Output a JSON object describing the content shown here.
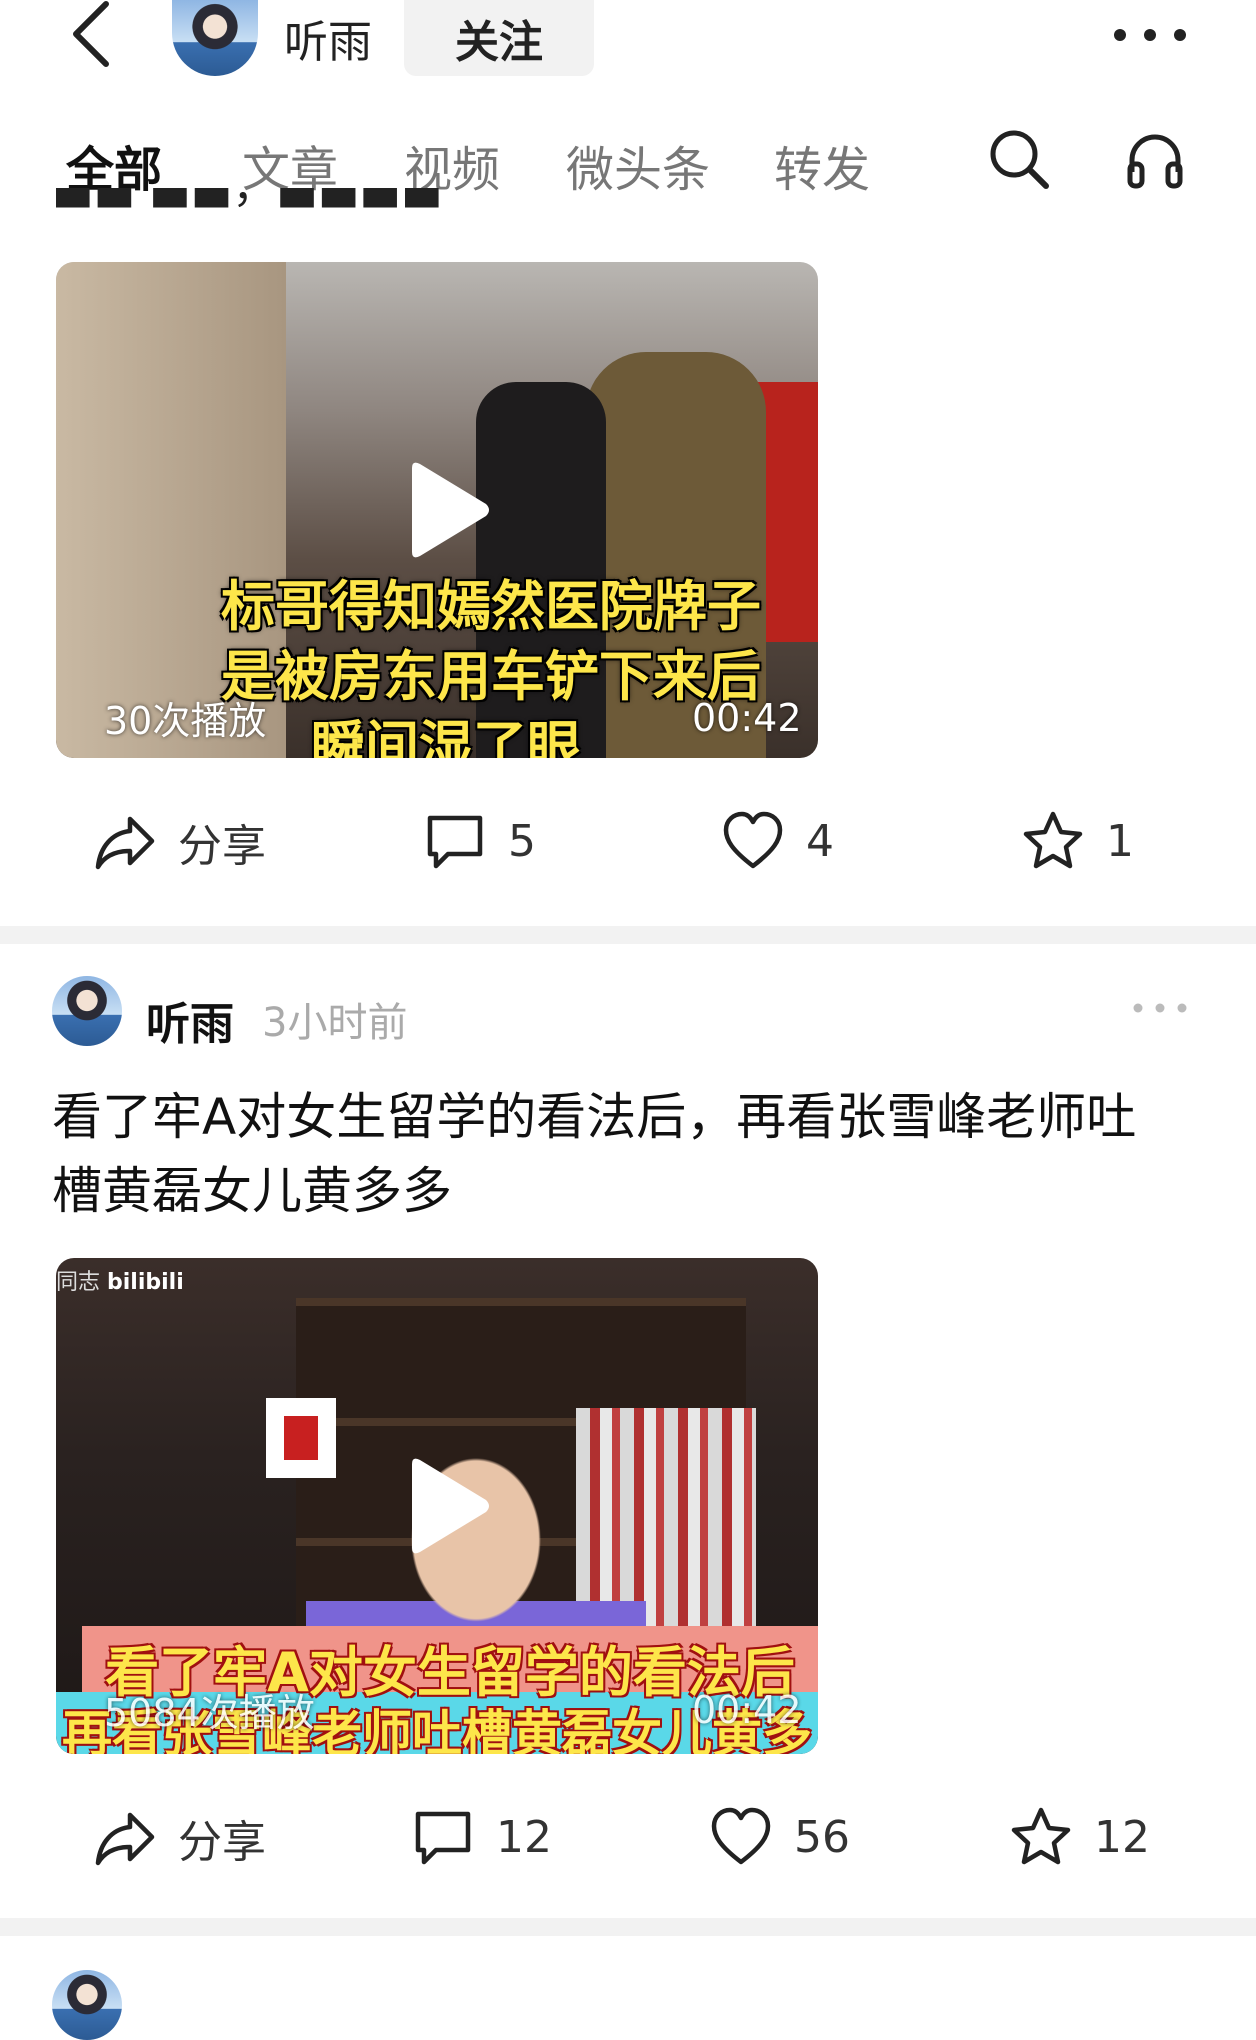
{
  "header": {
    "username": "听雨",
    "follow_label": "关注"
  },
  "tabs": [
    {
      "label": "全部",
      "active": true
    },
    {
      "label": "文章",
      "active": false
    },
    {
      "label": "视频",
      "active": false
    },
    {
      "label": "微头条",
      "active": false
    },
    {
      "label": "转发",
      "active": false
    }
  ],
  "posts": [
    {
      "video": {
        "caption_lines": [
          "标哥得知嫣然医院牌子",
          "是被房东用车铲下来后",
          "瞬间湿了眼眶"
        ],
        "play_count": "30次播放",
        "duration": "00:42"
      },
      "actions": {
        "share_label": "分享",
        "comments": "5",
        "likes": "4",
        "favorites": "1"
      }
    },
    {
      "author": "听雨",
      "time": "3小时前",
      "title": "看了牢A对女生留学的看法后，再看张雪峰老师吐槽黄磊女儿黄多多",
      "video": {
        "source_logo": "bilibili",
        "caption_lines": [
          "看了牢A对女生留学的看法后",
          "再看张雪峰老师吐槽黄磊女儿黄多多"
        ],
        "play_count": "5084次播放",
        "duration": "00:42"
      },
      "actions": {
        "share_label": "分享",
        "comments": "12",
        "likes": "56",
        "favorites": "12"
      }
    }
  ],
  "icons": {
    "back": "back-icon",
    "more": "more-icon",
    "search": "search-icon",
    "headphones": "headphones-icon",
    "share": "share-icon",
    "comment": "comment-icon",
    "like": "heart-icon",
    "favorite": "star-icon",
    "play": "play-icon"
  },
  "colors": {
    "background": "#ffffff",
    "divider": "#f2f2f2",
    "caption_yellow": "#fde64a"
  }
}
